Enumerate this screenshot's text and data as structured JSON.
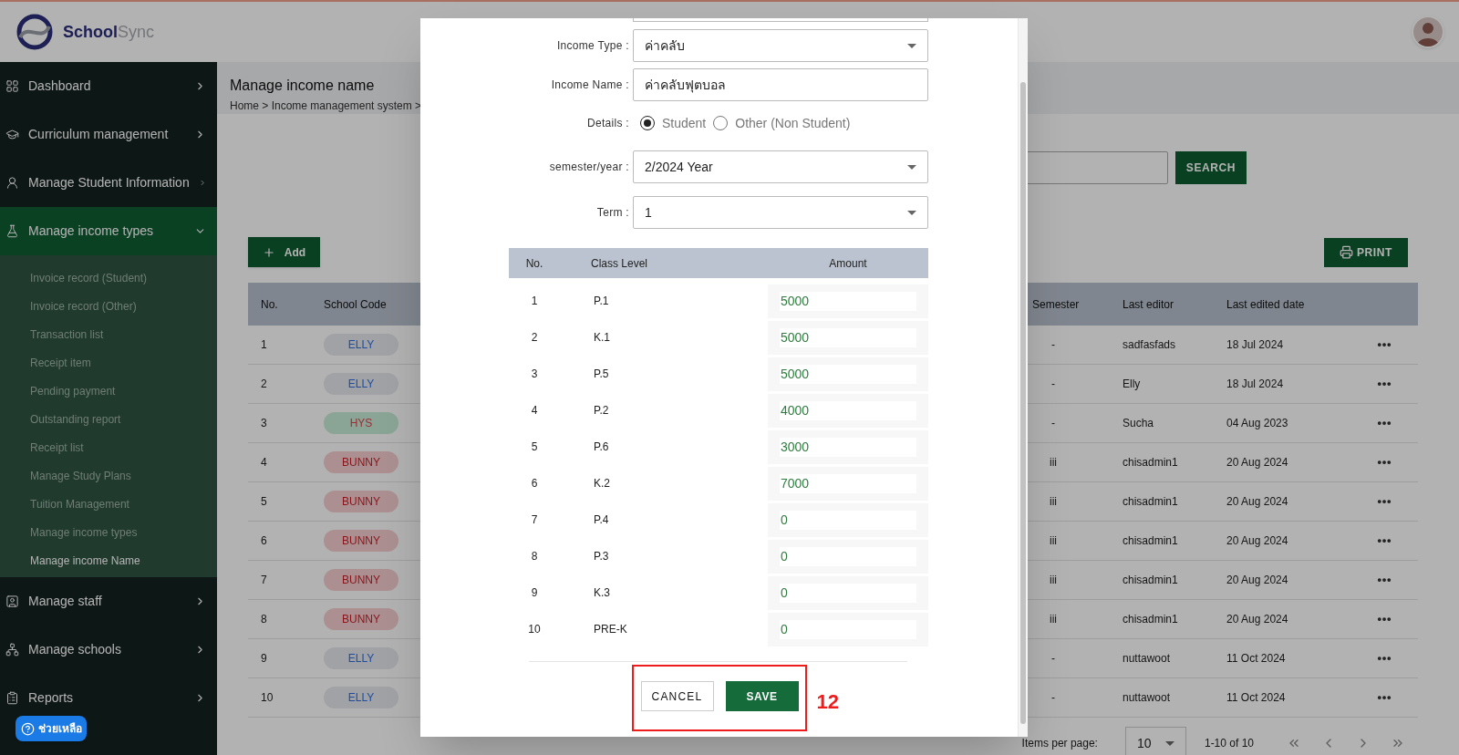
{
  "header": {
    "brand": {
      "first": "School",
      "second": "Sync"
    }
  },
  "sidebar": {
    "items": [
      {
        "label": "Dashboard",
        "expanded": false
      },
      {
        "label": "Curriculum management",
        "expanded": false
      },
      {
        "label": "Manage Student Information",
        "expanded": false
      },
      {
        "label": "Manage income types",
        "expanded": true,
        "children": [
          {
            "label": "Invoice record (Student)",
            "selected": false
          },
          {
            "label": "Invoice record (Other)",
            "selected": false
          },
          {
            "label": "Transaction list",
            "selected": false
          },
          {
            "label": "Receipt item",
            "selected": false
          },
          {
            "label": "Pending payment",
            "selected": false
          },
          {
            "label": "Outstanding report",
            "selected": false
          },
          {
            "label": "Receipt list",
            "selected": false
          },
          {
            "label": "Manage Study Plans",
            "selected": false
          },
          {
            "label": "Tuition Management",
            "selected": false
          },
          {
            "label": "Manage income types",
            "selected": false
          },
          {
            "label": "Manage income Name",
            "selected": true
          }
        ]
      },
      {
        "label": "Manage staff",
        "expanded": false
      },
      {
        "label": "Manage schools",
        "expanded": false
      },
      {
        "label": "Reports",
        "expanded": false
      }
    ]
  },
  "help_button": {
    "label": "ช่วยเหลือ"
  },
  "page": {
    "title": "Manage income name",
    "breadcrumb": "Home > Income management system >"
  },
  "search_button": "SEARCH",
  "add_button": "Add",
  "print_button": "PRINT",
  "table": {
    "columns": [
      "No.",
      "School Code",
      "Semester",
      "Last editor",
      "Last edited date"
    ],
    "rows": [
      {
        "no": "1",
        "school": {
          "text": "ELLY",
          "kind": "blue"
        },
        "semester": "-",
        "last_editor": "sadfasfads",
        "last_edited_date": "18 Jul 2024"
      },
      {
        "no": "2",
        "school": {
          "text": "ELLY",
          "kind": "blue"
        },
        "semester": "-",
        "last_editor": "Elly",
        "last_edited_date": "18 Jul 2024"
      },
      {
        "no": "3",
        "school": {
          "text": "HYS",
          "kind": "green"
        },
        "semester": "-",
        "last_editor": "Sucha",
        "last_edited_date": "04 Aug 2023"
      },
      {
        "no": "4",
        "school": {
          "text": "BUNNY",
          "kind": "red"
        },
        "semester": "iii",
        "last_editor": "chisadmin1",
        "last_edited_date": "20 Aug 2024"
      },
      {
        "no": "5",
        "school": {
          "text": "BUNNY",
          "kind": "red"
        },
        "semester": "iii",
        "last_editor": "chisadmin1",
        "last_edited_date": "20 Aug 2024"
      },
      {
        "no": "6",
        "school": {
          "text": "BUNNY",
          "kind": "red"
        },
        "semester": "iii",
        "last_editor": "chisadmin1",
        "last_edited_date": "20 Aug 2024"
      },
      {
        "no": "7",
        "school": {
          "text": "BUNNY",
          "kind": "red"
        },
        "semester": "iii",
        "last_editor": "chisadmin1",
        "last_edited_date": "20 Aug 2024"
      },
      {
        "no": "8",
        "school": {
          "text": "BUNNY",
          "kind": "red"
        },
        "semester": "iii",
        "last_editor": "chisadmin1",
        "last_edited_date": "20 Aug 2024"
      },
      {
        "no": "9",
        "school": {
          "text": "ELLY",
          "kind": "blue"
        },
        "semester": "-",
        "last_editor": "nuttawoot",
        "last_edited_date": "11 Oct 2024"
      },
      {
        "no": "10",
        "school": {
          "text": "ELLY",
          "kind": "blue"
        },
        "semester": "-",
        "last_editor": "nuttawoot",
        "last_edited_date": "11 Oct 2024"
      }
    ]
  },
  "pagination": {
    "label": "Items per page:",
    "per_page": "10",
    "range": "1-10 of 10"
  },
  "modal": {
    "fields": [
      {
        "kind": "select",
        "label": "Income Type :",
        "value": "ค่าคลับ"
      },
      {
        "kind": "text",
        "label": "Income Name :",
        "value": "ค่าคลับฟุตบอล"
      },
      {
        "kind": "radio",
        "label": "Details :",
        "options": [
          {
            "label": "Student",
            "selected": true
          },
          {
            "label": "Other (Non Student)",
            "selected": false
          }
        ]
      },
      {
        "kind": "select",
        "label": "semester/year :",
        "value": "2/2024 Year"
      },
      {
        "kind": "select",
        "label": "Term :",
        "value": "1"
      }
    ],
    "levels": {
      "columns": [
        "No.",
        "Class Level",
        "Amount"
      ],
      "rows": [
        {
          "no": "1",
          "class_level": "P.1",
          "amount": "5000"
        },
        {
          "no": "2",
          "class_level": "K.1",
          "amount": "5000"
        },
        {
          "no": "3",
          "class_level": "P.5",
          "amount": "5000"
        },
        {
          "no": "4",
          "class_level": "P.2",
          "amount": "4000"
        },
        {
          "no": "5",
          "class_level": "P.6",
          "amount": "3000"
        },
        {
          "no": "6",
          "class_level": "K.2",
          "amount": "7000"
        },
        {
          "no": "7",
          "class_level": "P.4",
          "amount": "0"
        },
        {
          "no": "8",
          "class_level": "P.3",
          "amount": "0"
        },
        {
          "no": "9",
          "class_level": "K.3",
          "amount": "0"
        },
        {
          "no": "10",
          "class_level": "PRE-K",
          "amount": "0"
        }
      ]
    },
    "cancel_button": "CANCEL",
    "save_button": "SAVE",
    "annotation": {
      "label": "12"
    }
  }
}
